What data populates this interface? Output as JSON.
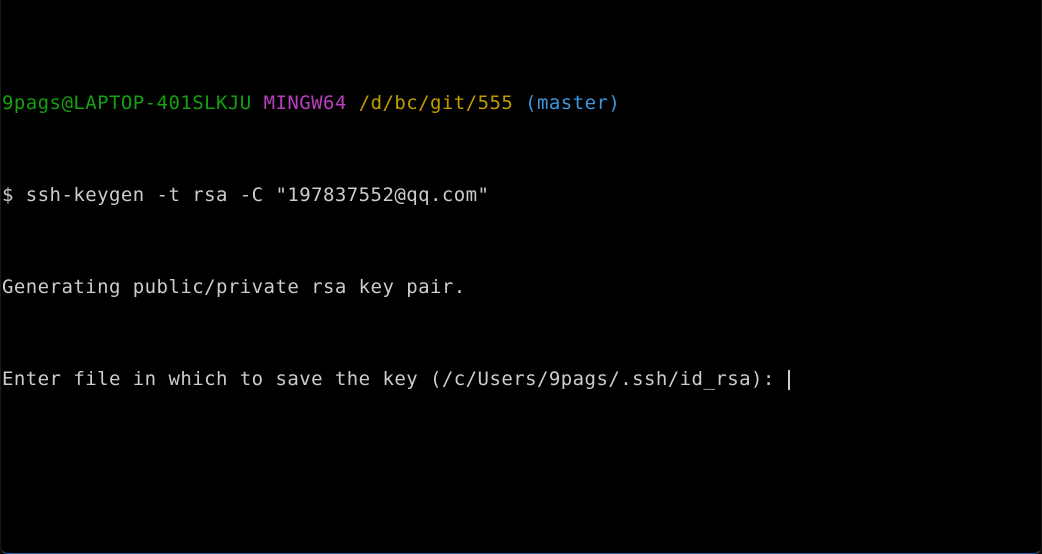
{
  "colors": {
    "background": "#000000",
    "default_text": "#cccccc",
    "user_host": "#13a10e",
    "msystem": "#b83fbf",
    "path": "#c19c00",
    "branch": "#3a96dd",
    "cursor": "#cccccc"
  },
  "prompt": {
    "user_host": "9pags@LAPTOP-401SLKJU",
    "msystem": "MINGW64",
    "path": "/d/bc/git/555",
    "branch": "(master)"
  },
  "command": {
    "symbol": "$",
    "text": "ssh-keygen -t rsa -C \"197837552@qq.com\""
  },
  "output": [
    "Generating public/private rsa key pair.",
    "Enter file in which to save the key (/c/Users/9pags/.ssh/id_rsa): "
  ]
}
